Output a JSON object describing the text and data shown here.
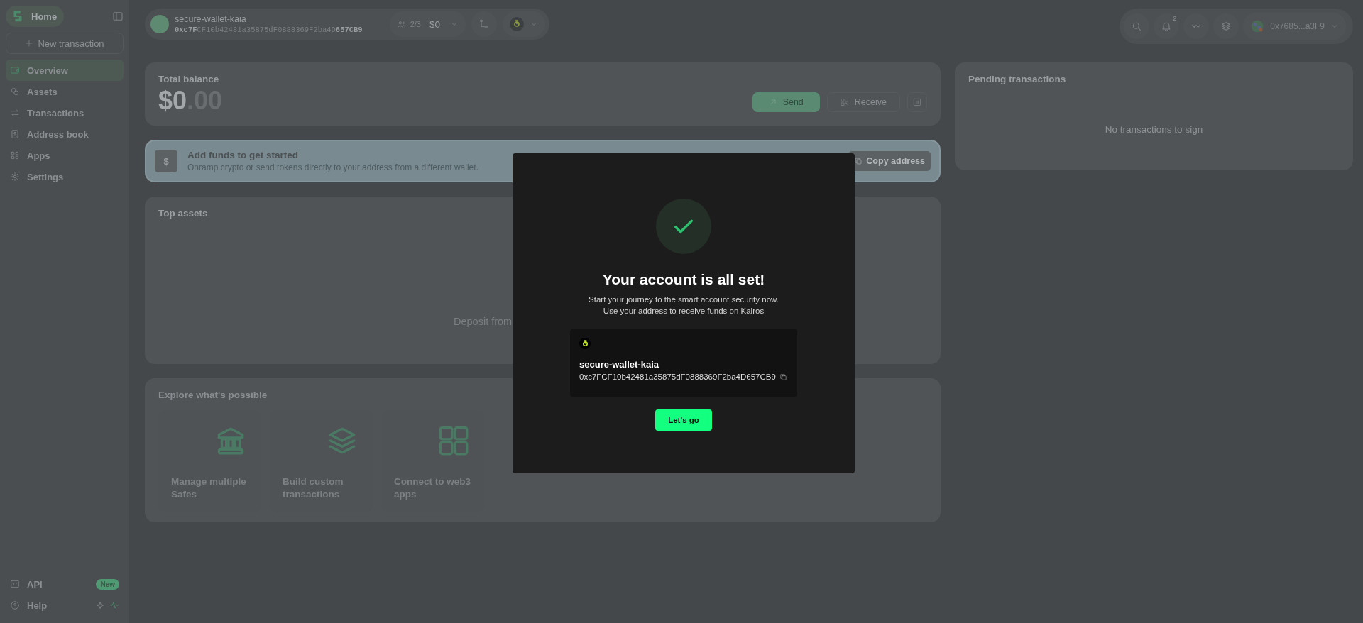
{
  "sidebar": {
    "home": "Home",
    "new_transaction": "New transaction",
    "items": [
      {
        "label": "Overview",
        "kind": "wallet",
        "selected": true
      },
      {
        "label": "Assets",
        "kind": "coins",
        "selected": false
      },
      {
        "label": "Transactions",
        "kind": "arrows",
        "selected": false
      },
      {
        "label": "Address book",
        "kind": "book",
        "selected": false
      },
      {
        "label": "Apps",
        "kind": "grid",
        "selected": false
      },
      {
        "label": "Settings",
        "kind": "gear",
        "selected": false
      }
    ],
    "api": {
      "label": "API",
      "badge": "New"
    },
    "help": {
      "label": "Help"
    }
  },
  "safe_header": {
    "name": "secure-wallet-kaia",
    "address": "**0xc7F**CF10b42481a35875dF0888369F2ba4D**657CB9**",
    "owners": "2/3",
    "balance": "$0"
  },
  "top_bar": {
    "notification_count": "2",
    "account": "0x7685...a3F9"
  },
  "balance": {
    "title": "Total balance",
    "amount": "$0",
    "decimals": ".00",
    "send": "Send",
    "receive": "Receive"
  },
  "add_funds": {
    "badge": "$",
    "title": "Add funds to get started",
    "description": "Onramp crypto or send tokens directly to your address from a different wallet.",
    "button": "Copy address"
  },
  "top_assets": {
    "title": "Top assets",
    "empty": "Deposit from"
  },
  "explore": {
    "title": "Explore what's possible",
    "cards": [
      {
        "label": "Manage multiple Safes",
        "kind": "bank"
      },
      {
        "label": "Build custom transactions",
        "kind": "layers"
      },
      {
        "label": "Connect to web3 apps",
        "kind": "grid"
      }
    ]
  },
  "pending": {
    "title": "Pending transactions",
    "empty": "No transactions to sign"
  },
  "modal": {
    "title": "Your account is all set!",
    "lines": [
      "Start your journey to the smart account security now.",
      "Use your address to receive funds on Kairos"
    ],
    "safe_name": "secure-wallet-kaia",
    "address": "0xc7FCF10b42481a35875dF0888369F2ba4D657CB9",
    "button": "Let's go"
  }
}
